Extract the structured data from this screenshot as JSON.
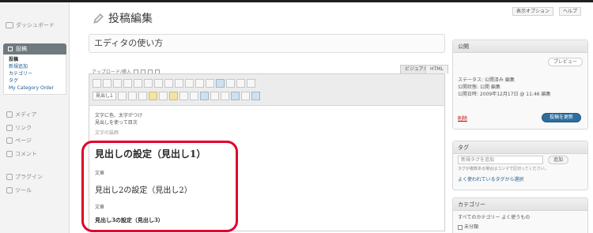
{
  "sidebar": {
    "dashboard": "ダッシュボード",
    "posts": {
      "label": "投稿",
      "items": [
        "投稿",
        "新規追加",
        "カテゴリー",
        "タグ",
        "My Category Order"
      ]
    },
    "media": "メディア",
    "links": "リンク",
    "pages": "ページ",
    "comments": "コメント",
    "appearance": "外観",
    "plugins": "プラグイン",
    "tools": "ツール"
  },
  "header": {
    "title": "投稿編集",
    "screen_options": "表示オプション",
    "help": "ヘルプ"
  },
  "editor": {
    "post_title": "エディタの使い方",
    "upload_insert": "アップロード/挿入",
    "tab_visual": "ビジュアル",
    "tab_html": "HTML",
    "format_select": "見出し1",
    "intro_line1": "文字に色、太字がつけ",
    "intro_line2": "見出しを使って目次",
    "intro_small": "文字の装飾",
    "heading1": "見出しの設定（見出し1）",
    "text1": "文章",
    "heading2": "見出し2の設定（見出し2）",
    "text2": "文章",
    "heading3": "見出し3の設定（見出し3）"
  },
  "publish": {
    "title": "公開",
    "preview": "プレビュー",
    "status": "ステータス: 公開済み 編集",
    "visibility": "公開状態: 公開 編集",
    "date": "公開日時: 2009年12月17日 @ 11:46 編集",
    "delete": "削除",
    "update": "投稿を更新"
  },
  "tags": {
    "title": "タグ",
    "placeholder": "新規タグを追加",
    "add": "追加",
    "hint": "タグが複数ある場合はコンマで区切ってください。",
    "popular": "よく使われているタグから選択"
  },
  "categories": {
    "title": "カテゴリー",
    "tabs": "すべてのカテゴリー  よく使うもの",
    "first": "未分類"
  }
}
